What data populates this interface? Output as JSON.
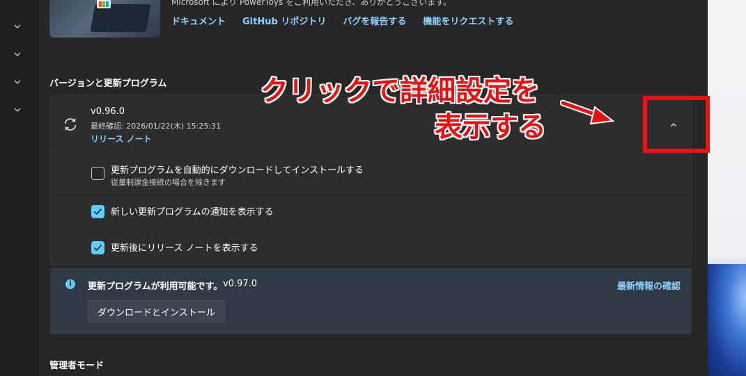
{
  "top": {
    "cut_text": "Microsoft により PowerToys をご利用いただき、ありがとうございます。",
    "links": [
      "ドキュメント",
      "GitHub リポジトリ",
      "バグを報告する",
      "機能をリクエストする"
    ]
  },
  "version_section": {
    "title": "バージョンと更新プログラム",
    "version": "v0.96.0",
    "last_checked": "最終確認:  2026/01/22(木) 15:25:31",
    "release_notes_link": "リリース ノート",
    "collapse_icon": "chevron-up-icon"
  },
  "options": [
    {
      "label": "更新プログラムを自動的にダウンロードしてインストールする",
      "sub": "従量制課金接続の場合を除きます",
      "checked": false
    },
    {
      "label": "新しい更新プログラムの通知を表示する",
      "checked": true
    },
    {
      "label": "更新後にリリース ノートを表示する",
      "checked": true
    }
  ],
  "info_bar": {
    "title": "更新プログラムが利用可能です。",
    "version": "v0.97.0",
    "link": "最新情報の確認",
    "button": "ダウンロードとインストール",
    "icon": "info-icon"
  },
  "admin_section": {
    "title": "管理者モード"
  },
  "annotation": {
    "line1": "クリックで詳細設定を",
    "line2": "表示する",
    "color": "#e81212"
  },
  "colors": {
    "accent": "#60cdff",
    "link": "#8fd1ff",
    "background": "#272727",
    "card": "#2d2d2d"
  }
}
